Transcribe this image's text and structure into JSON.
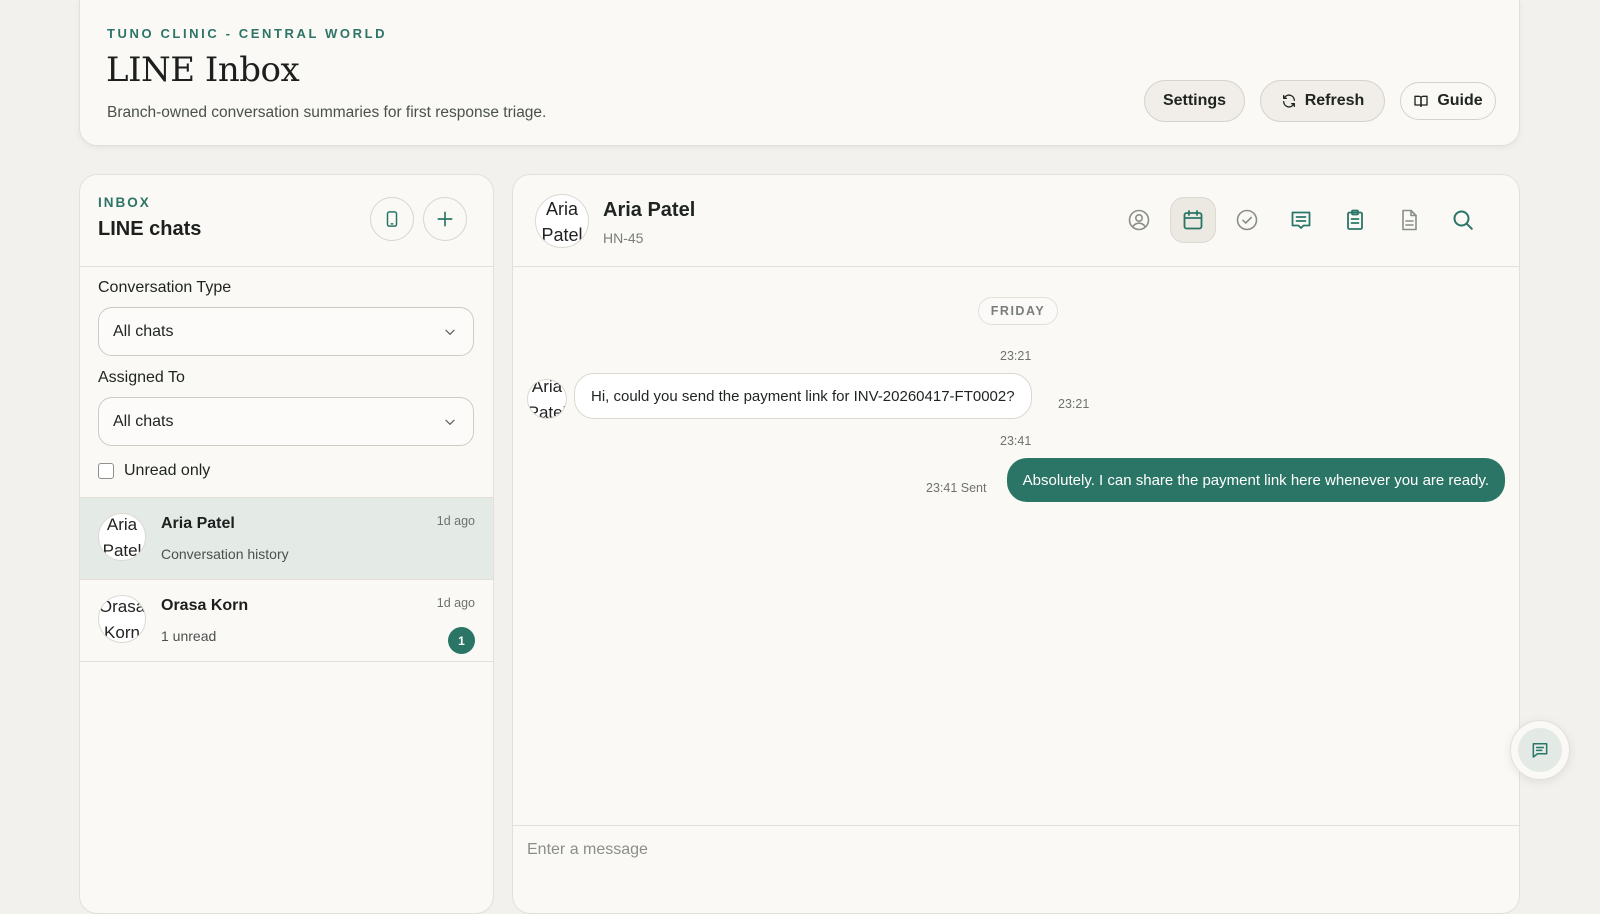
{
  "header": {
    "eyebrow": "TUNO CLINIC - CENTRAL WORLD",
    "title": "LINE Inbox",
    "subtitle": "Branch-owned conversation summaries for first response triage.",
    "buttons": {
      "settings": "Settings",
      "refresh": "Refresh",
      "guide": "Guide"
    }
  },
  "sidebar": {
    "eyebrow": "INBOX",
    "title": "LINE chats",
    "conversation_type": {
      "label": "Conversation Type",
      "value": "All chats"
    },
    "assigned_to": {
      "label": "Assigned To",
      "value": "All chats"
    },
    "unread_only": {
      "label": "Unread only",
      "checked": false
    },
    "chats": [
      {
        "avatar": "Aria Patel",
        "name": "Aria Patel",
        "preview": "Conversation history",
        "time": "1d ago",
        "unread": null,
        "active": true
      },
      {
        "avatar": "Orasa Korn",
        "name": "Orasa Korn",
        "preview": "1 unread",
        "time": "1d ago",
        "unread": "1",
        "active": false
      }
    ]
  },
  "conversation": {
    "avatar": "Aria Patel",
    "name": "Aria Patel",
    "hn": "HN-45",
    "toolbar_icons": [
      "profile-icon",
      "calendar-icon",
      "check-circle-icon",
      "message-lines-icon",
      "clipboard-icon",
      "document-icon",
      "search-icon"
    ],
    "day_label": "FRIDAY",
    "messages": [
      {
        "direction": "in",
        "avatar": "Aria Patel",
        "text": "Hi, could you send the payment link for INV-20260417-FT0002?",
        "time_above": "23:21",
        "time_side": "23:21"
      },
      {
        "direction": "out",
        "text": "Absolutely. I can share the payment link here whenever you are ready.",
        "time_above": "23:41",
        "time_side": "23:41 Sent"
      }
    ],
    "composer_placeholder": "Enter a message"
  },
  "colors": {
    "accent": "#2a7566",
    "background": "#f3f1ed",
    "panel": "#faf9f6",
    "active_row": "#e4ebe7"
  }
}
